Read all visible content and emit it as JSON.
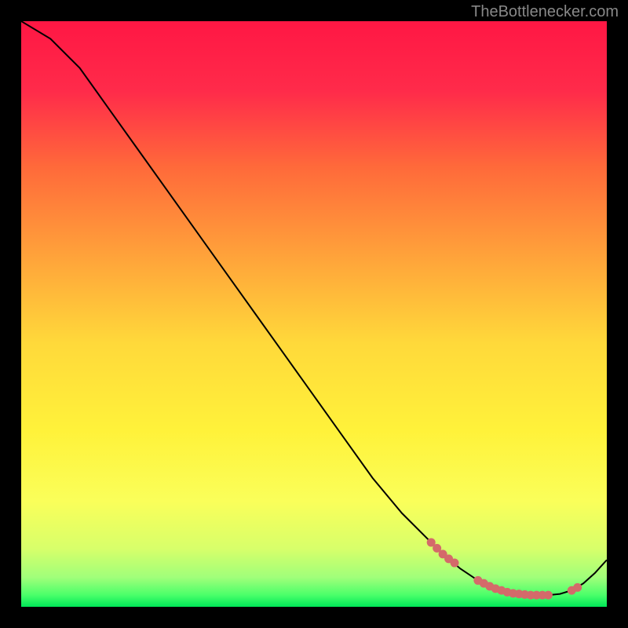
{
  "attribution": "TheBottlenecker.com",
  "chart_data": {
    "type": "line",
    "title": "",
    "xlabel": "",
    "ylabel": "",
    "xlim": [
      0,
      100
    ],
    "ylim": [
      0,
      100
    ],
    "series": [
      {
        "name": "curve",
        "stroke": "#000000",
        "x": [
          0,
          5,
          10,
          15,
          20,
          25,
          30,
          35,
          40,
          45,
          50,
          55,
          60,
          65,
          70,
          72,
          75,
          78,
          80,
          82,
          85,
          88,
          90,
          92,
          94,
          96,
          98,
          100
        ],
        "y": [
          100,
          97,
          92,
          85,
          78,
          71,
          64,
          57,
          50,
          43,
          36,
          29,
          22,
          16,
          11,
          9,
          6.5,
          4.5,
          3.5,
          2.8,
          2.2,
          2.0,
          2.0,
          2.2,
          2.8,
          4.0,
          5.8,
          8.0
        ]
      }
    ],
    "highlight_points": {
      "stroke": "#d46a6a",
      "x": [
        70,
        71,
        72,
        73,
        74,
        78,
        79,
        80,
        81,
        82,
        83,
        84,
        85,
        86,
        87,
        88,
        89,
        90,
        94,
        95
      ],
      "y": [
        11,
        10,
        9,
        8.2,
        7.5,
        4.5,
        4.0,
        3.5,
        3.1,
        2.8,
        2.5,
        2.3,
        2.2,
        2.1,
        2.0,
        2.0,
        2.0,
        2.0,
        2.8,
        3.3
      ]
    },
    "gradient_stops": [
      {
        "offset": 0.0,
        "color": "#ff1744"
      },
      {
        "offset": 0.12,
        "color": "#ff2b4a"
      },
      {
        "offset": 0.25,
        "color": "#ff6a3a"
      },
      {
        "offset": 0.4,
        "color": "#ffa23a"
      },
      {
        "offset": 0.55,
        "color": "#ffd93a"
      },
      {
        "offset": 0.7,
        "color": "#fff23a"
      },
      {
        "offset": 0.82,
        "color": "#faff5a"
      },
      {
        "offset": 0.9,
        "color": "#d8ff6a"
      },
      {
        "offset": 0.95,
        "color": "#a0ff7a"
      },
      {
        "offset": 0.98,
        "color": "#4aff6a"
      },
      {
        "offset": 1.0,
        "color": "#00e858"
      }
    ]
  }
}
